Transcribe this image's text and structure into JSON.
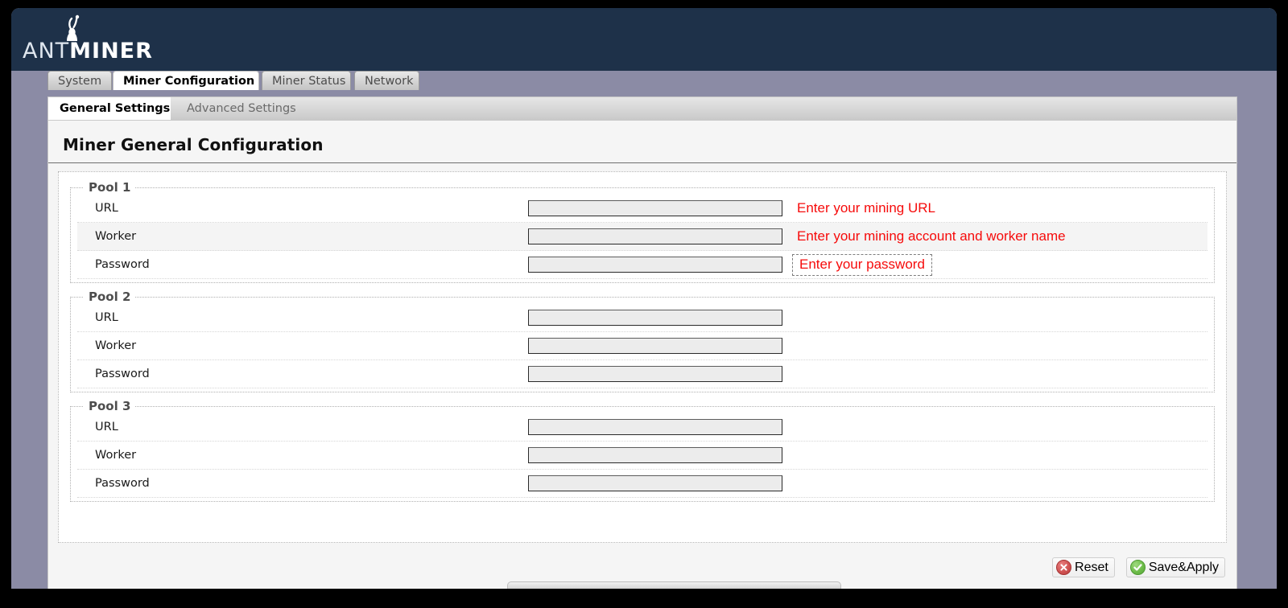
{
  "brand": {
    "name_part1": "ANT",
    "name_part2": "MINER",
    "logo_icon": "ant-icon",
    "header_bg": "#1e3149"
  },
  "tabs": [
    {
      "label": "System",
      "active": false
    },
    {
      "label": "Miner Configuration",
      "active": true
    },
    {
      "label": "Miner Status",
      "active": false
    },
    {
      "label": "Network",
      "active": false
    }
  ],
  "subtabs": [
    {
      "label": "General Settings",
      "active": true
    },
    {
      "label": "Advanced Settings",
      "active": false
    }
  ],
  "page": {
    "title": "Miner General Configuration"
  },
  "hint_color": "#f60b0b",
  "pools": [
    {
      "legend": "Pool 1",
      "rows": [
        {
          "label": "URL",
          "value": "",
          "placeholder": "",
          "hint": "Enter your mining URL",
          "hint_boxed": false,
          "alt": false
        },
        {
          "label": "Worker",
          "value": "",
          "placeholder": "",
          "hint": "Enter your mining account and worker name",
          "hint_boxed": false,
          "alt": true
        },
        {
          "label": "Password",
          "value": "",
          "placeholder": "",
          "hint": "Enter your password",
          "hint_boxed": true,
          "alt": false
        }
      ]
    },
    {
      "legend": "Pool 2",
      "rows": [
        {
          "label": "URL",
          "value": "",
          "placeholder": "",
          "hint": "",
          "hint_boxed": false,
          "alt": false
        },
        {
          "label": "Worker",
          "value": "",
          "placeholder": "",
          "hint": "",
          "hint_boxed": false,
          "alt": false
        },
        {
          "label": "Password",
          "value": "",
          "placeholder": "",
          "hint": "",
          "hint_boxed": false,
          "alt": false
        }
      ]
    },
    {
      "legend": "Pool 3",
      "rows": [
        {
          "label": "URL",
          "value": "",
          "placeholder": "",
          "hint": "",
          "hint_boxed": false,
          "alt": false
        },
        {
          "label": "Worker",
          "value": "",
          "placeholder": "",
          "hint": "",
          "hint_boxed": false,
          "alt": false
        },
        {
          "label": "Password",
          "value": "",
          "placeholder": "",
          "hint": "",
          "hint_boxed": false,
          "alt": false
        }
      ]
    }
  ],
  "footer": {
    "reset_label": "Reset",
    "reset_icon": "cancel-icon",
    "save_label": "Save&Apply",
    "save_icon": "check-circle-icon"
  }
}
